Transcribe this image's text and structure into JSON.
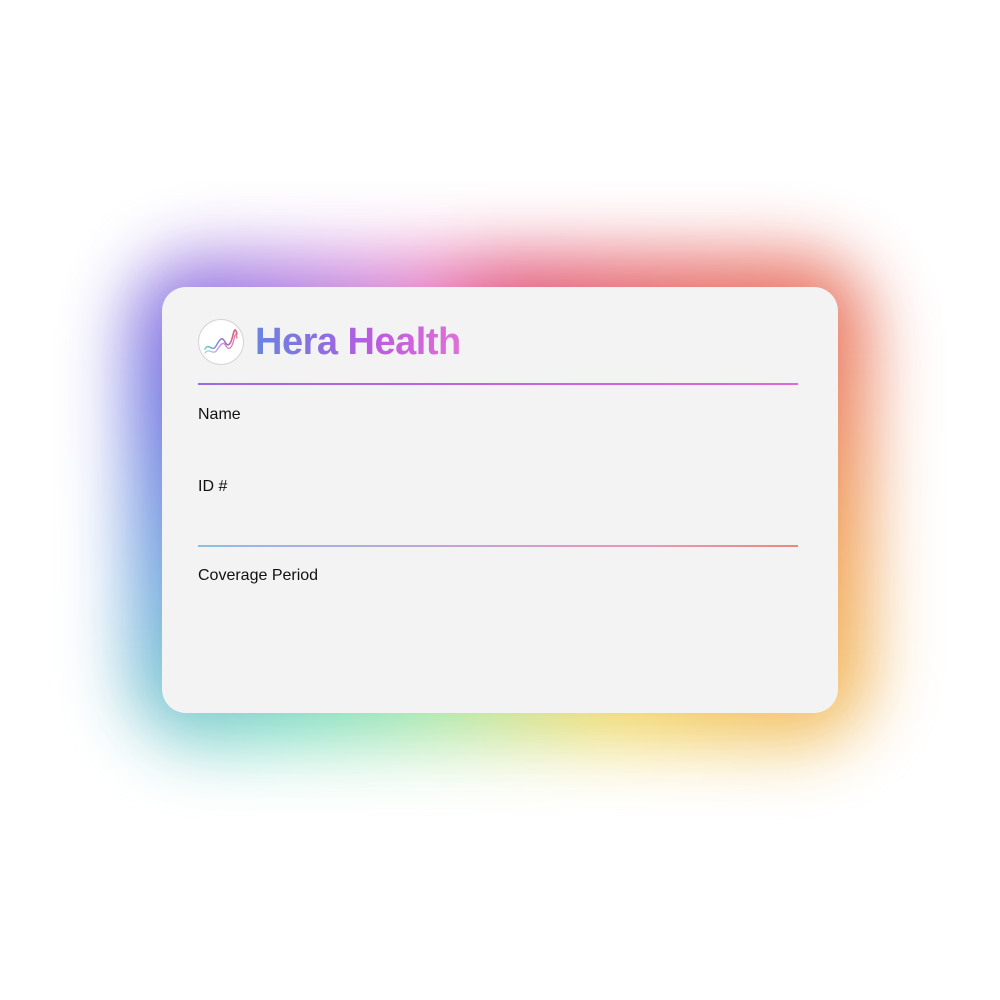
{
  "card": {
    "brand_name": "Hera Health",
    "logo_icon": "wave-lines-icon",
    "fields": {
      "name_label": "Name",
      "id_label": "ID #",
      "coverage_label": "Coverage Period"
    }
  },
  "colors": {
    "card_background": "#f3f3f3",
    "brand_gradient_start": "#6a84e0",
    "brand_gradient_end": "#e070d8",
    "divider_top": "#c464e0",
    "divider_bottom_start": "#8cc0e0",
    "divider_bottom_end": "#e88a78"
  }
}
